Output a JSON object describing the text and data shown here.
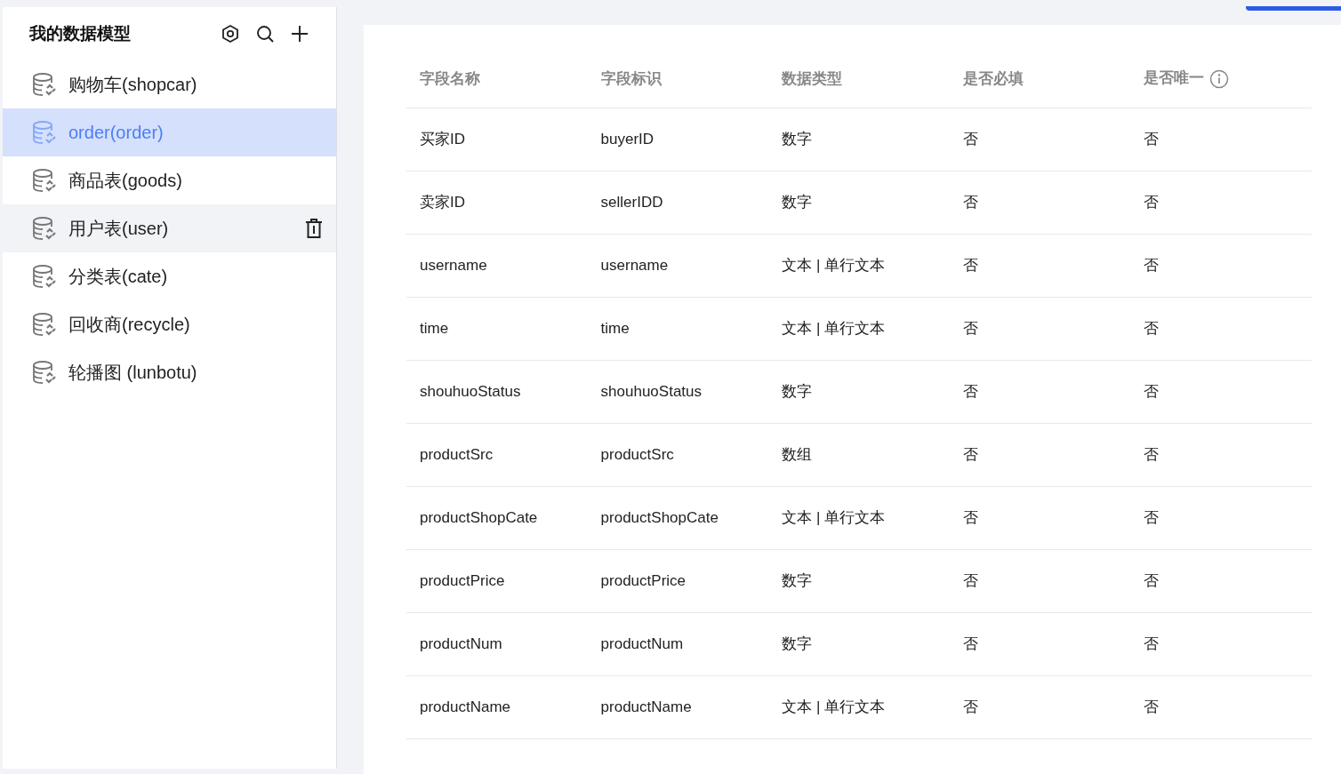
{
  "sidebar": {
    "title": "我的数据模型",
    "items": [
      {
        "label": "购物车(shopcar)",
        "selected": false,
        "hovered": false
      },
      {
        "label": "order(order)",
        "selected": true,
        "hovered": false
      },
      {
        "label": "商品表(goods)",
        "selected": false,
        "hovered": false
      },
      {
        "label": "用户表(user)",
        "selected": false,
        "hovered": true
      },
      {
        "label": "分类表(cate)",
        "selected": false,
        "hovered": false
      },
      {
        "label": "回收商(recycle)",
        "selected": false,
        "hovered": false
      },
      {
        "label": "轮播图 (lunbotu)",
        "selected": false,
        "hovered": false
      }
    ]
  },
  "table": {
    "columns": [
      {
        "label": "字段名称"
      },
      {
        "label": "字段标识"
      },
      {
        "label": "数据类型"
      },
      {
        "label": "是否必填"
      },
      {
        "label": "是否唯一",
        "info": true
      }
    ],
    "rows": [
      [
        "买家ID",
        "buyerID",
        "数字",
        "否",
        "否"
      ],
      [
        "卖家ID",
        "sellerIDD",
        "数字",
        "否",
        "否"
      ],
      [
        "username",
        "username",
        "文本 | 单行文本",
        "否",
        "否"
      ],
      [
        "time",
        "time",
        "文本 | 单行文本",
        "否",
        "否"
      ],
      [
        "shouhuoStatus",
        "shouhuoStatus",
        "数字",
        "否",
        "否"
      ],
      [
        "productSrc",
        "productSrc",
        "数组",
        "否",
        "否"
      ],
      [
        "productShopCate",
        "productShopCate",
        "文本 | 单行文本",
        "否",
        "否"
      ],
      [
        "productPrice",
        "productPrice",
        "数字",
        "否",
        "否"
      ],
      [
        "productNum",
        "productNum",
        "数字",
        "否",
        "否"
      ],
      [
        "productName",
        "productName",
        "文本 | 单行文本",
        "否",
        "否"
      ]
    ]
  },
  "top_tab": {
    "selected": true
  }
}
